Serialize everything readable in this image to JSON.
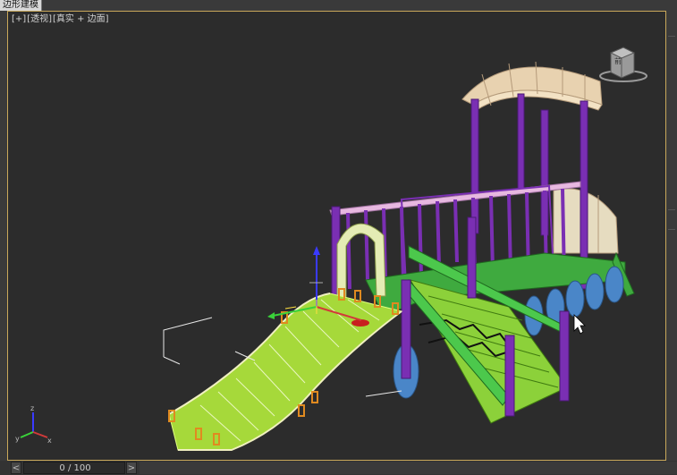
{
  "tab": {
    "title": "边形建模"
  },
  "viewport": {
    "label_parts": [
      "[+]",
      "[透视]",
      "[真实 + 边面]"
    ]
  },
  "viewcube": {
    "face_label": "前"
  },
  "timeline": {
    "prev_label": "<",
    "next_label": ">",
    "frame_text": "0 / 100"
  },
  "colors": {
    "viewport_bg": "#2c2c2c",
    "active_border": "#c9a85a",
    "post_purple": "#7a2fb3",
    "slide_green": "#9acd32",
    "wheel_blue": "#4a86c8",
    "roof_cream": "#e8d2b0"
  },
  "icons": [
    "axis-gizmo-icon",
    "move-gizmo-icon",
    "viewcube-icon",
    "mouse-cursor-icon"
  ]
}
